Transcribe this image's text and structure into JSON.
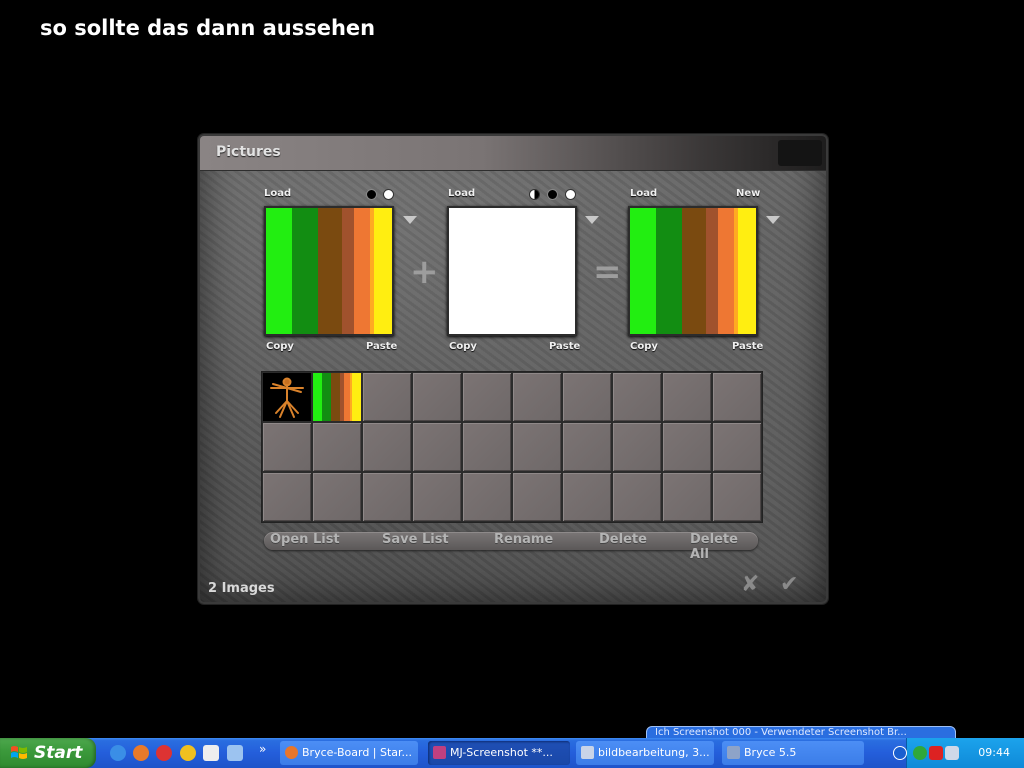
{
  "headline": "so sollte das dann aussehen",
  "dialog": {
    "title": "Pictures",
    "panels": [
      {
        "top_left": "Load",
        "top_right": "",
        "bottom_left": "Copy",
        "bottom_right": "Paste",
        "dots": [
          "black",
          "white"
        ]
      },
      {
        "top_left": "Load",
        "top_right": "",
        "bottom_left": "Copy",
        "bottom_right": "Paste",
        "dots": [
          "half",
          "black",
          "white"
        ]
      },
      {
        "top_left": "Load",
        "top_right": "New",
        "bottom_left": "Copy",
        "bottom_right": "Paste",
        "dots": []
      }
    ],
    "operators": {
      "plus": "+",
      "equals": "="
    },
    "stripe_colors": [
      "#22ee11",
      "#128d12",
      "#7a4a10",
      "#a0522d",
      "#ee7733",
      "#ffaa22",
      "#ffee11"
    ],
    "buttons": [
      "Open List",
      "Save List",
      "Rename",
      "Delete",
      "Delete All"
    ],
    "status": "2 Images",
    "cancel_symbol": "✘",
    "ok_symbol": "✔"
  },
  "taskbar": {
    "start_label": "Start",
    "chevron": "»",
    "tasks": [
      {
        "label": "Bryce-Board | Star...",
        "active": false,
        "icon_color": "#e8762b"
      },
      {
        "label": "MJ-Screenshot **...",
        "active": true,
        "icon_color": "#c04080"
      },
      {
        "label": "bildbearbeitung, 3...",
        "active": false,
        "icon_color": "#c9d4e8"
      },
      {
        "label": "Bryce 5.5",
        "active": false,
        "icon_color": "#8ea3c8"
      }
    ],
    "clock": "09:44",
    "balloon_text": "Ich Screenshot 000 - Verwendeter Screenshot Br..."
  }
}
